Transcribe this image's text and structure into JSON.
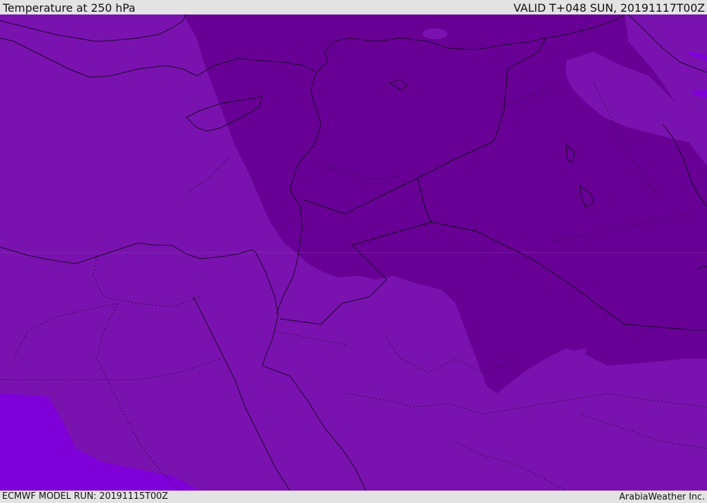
{
  "header": {
    "title": "Temperature at 250 hPa",
    "valid": "VALID T+048 SUN, 20191117T00Z"
  },
  "footer": {
    "model_run": "ECMWF MODEL RUN: 20191115T00Z",
    "credit": "ArabiaWeather Inc."
  },
  "map": {
    "colors": {
      "base": "#7a12b0",
      "cold": "#680096",
      "warm": "#7f00d8",
      "coast": "#1a0a28",
      "border": "#14081f"
    }
  }
}
